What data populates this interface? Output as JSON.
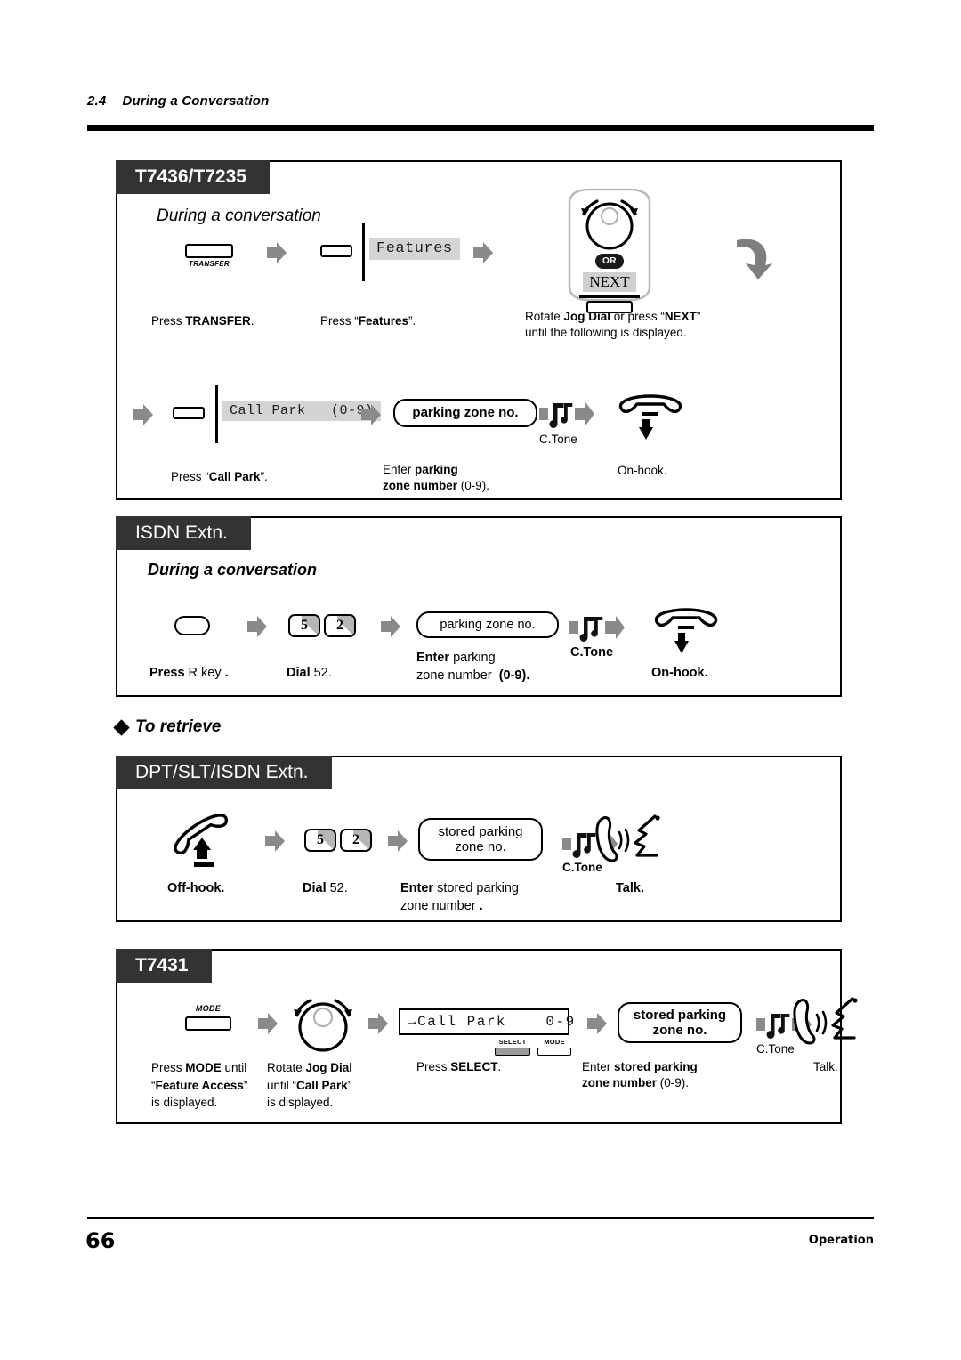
{
  "header": {
    "section_number": "2.4",
    "section_title": "During a Conversation"
  },
  "footer": {
    "page_number": "66",
    "label": "Operation"
  },
  "retrieve_heading": "To retrieve",
  "panels": [
    {
      "tab": "T7436/T7235",
      "title": "During a conversation",
      "row1": {
        "key_transfer_label": "TRANSFER",
        "caption_transfer": "Press TRANSFER.",
        "lcd_features": "Features",
        "caption_features": "Press “Features”.",
        "or_label": "OR",
        "next_label": "NEXT",
        "caption_jog_line1": "Rotate Jog Dial or press “NEXT”",
        "caption_jog_line2": "until the following is displayed."
      },
      "row2": {
        "lcd_callpark": "Call Park   (0-9)",
        "caption_callpark": "Press “Call Park”.",
        "bubble_zone": "parking zone no.",
        "caption_zone_line1": "Enter parking",
        "caption_zone_line2": "zone number (0-9).",
        "ctone_label": "C.Tone",
        "caption_onhook": "On-hook."
      }
    },
    {
      "tab": "ISDN Extn.",
      "title": "During a conversation",
      "row1": {
        "caption_rkey": "Press R key .",
        "digits": [
          "5",
          "2"
        ],
        "caption_dial": "Dial 52.",
        "bubble_zone": "parking zone no.",
        "caption_zone_line1": "Enter parking",
        "caption_zone_line2": "zone number  (0-9).",
        "ctone_label": "C.Tone",
        "caption_onhook": "On-hook."
      }
    },
    {
      "tab": "DPT/SLT/ISDN Extn.",
      "row1": {
        "caption_offhook": "Off-hook.",
        "digits": [
          "5",
          "2"
        ],
        "caption_dial": "Dial 52.",
        "bubble_zone_line1": "stored parking",
        "bubble_zone_line2": "zone no.",
        "caption_zone_line1": "Enter stored parking",
        "caption_zone_line2": "zone number .",
        "ctone_label": "C.Tone",
        "caption_talk": "Talk."
      }
    },
    {
      "tab": "T7431",
      "row1": {
        "key_mode_label": "MODE",
        "caption_mode_line1": "Press MODE until",
        "caption_mode_line2": "“Feature Access”",
        "caption_mode_line3": "is displayed.",
        "caption_jog_line1": "Rotate Jog Dial",
        "caption_jog_line2": "until “Call Park”",
        "caption_jog_line3": "is displayed.",
        "lcd_callpark": "→Call Park    0-9",
        "softkey_select": "SELECT",
        "softkey_mode": "MODE",
        "caption_select": "Press SELECT.",
        "bubble_zone_line1": "stored parking",
        "bubble_zone_line2": "zone no.",
        "caption_zone_line1": "Enter stored parking",
        "caption_zone_line2": "zone number (0-9).",
        "ctone_label": "C.Tone",
        "caption_talk": "Talk."
      }
    }
  ],
  "colors": {
    "tab_bg": "#333333",
    "lcd_highlight": "#d4d4d4",
    "arrow_grey": "#8a8a8a",
    "key_shade": "#b6b6b6"
  }
}
